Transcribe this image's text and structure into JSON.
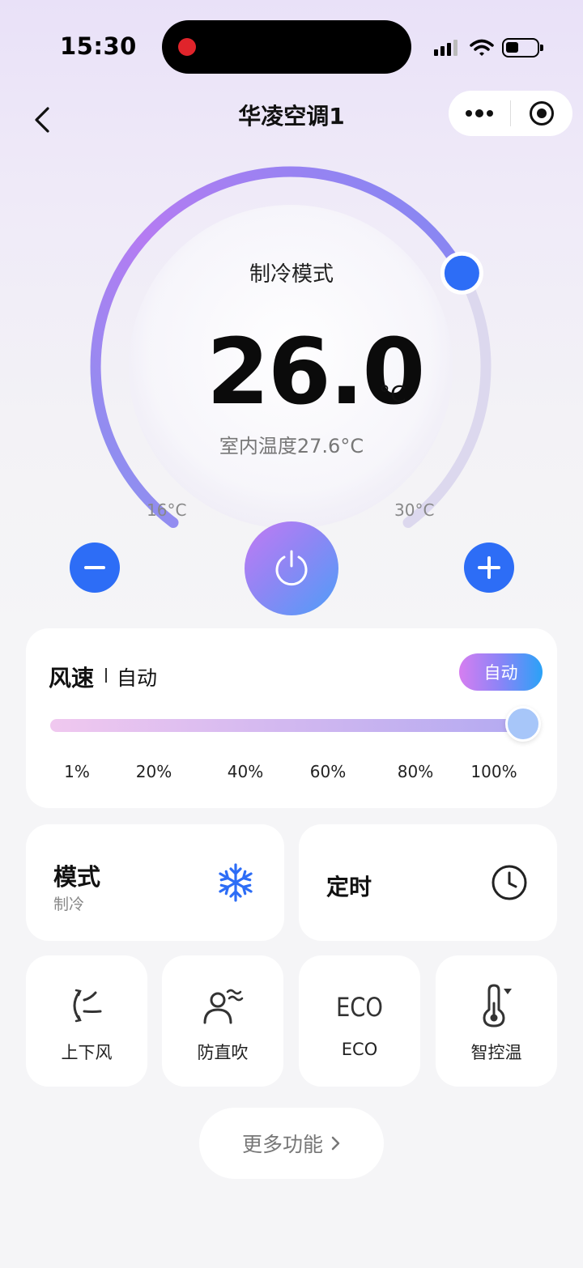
{
  "status_bar": {
    "time": "15:30"
  },
  "nav": {
    "title": "华凌空调1"
  },
  "thermostat": {
    "mode_label": "制冷模式",
    "set_temp": "26.0",
    "unit": "°C",
    "indoor_text": "室内温度27.6°C",
    "min_label": "16°C",
    "max_label": "30°C",
    "min_value": 16,
    "max_value": 30,
    "current_value": 26
  },
  "fan": {
    "title": "风速",
    "value": "自动",
    "auto_button": "自动",
    "level_percent": 100,
    "ticks": [
      "1%",
      "20%",
      "40%",
      "60%",
      "80%",
      "100%"
    ]
  },
  "mode_card": {
    "title": "模式",
    "subtitle": "制冷"
  },
  "timer_card": {
    "title": "定时"
  },
  "functions": [
    {
      "label": "上下风",
      "icon": "swing-icon"
    },
    {
      "label": "防直吹",
      "icon": "anti-direct-blow-icon"
    },
    {
      "label": "ECO",
      "icon": "eco-icon",
      "icon_text": "ECO"
    },
    {
      "label": "智控温",
      "icon": "smart-thermometer-icon"
    }
  ],
  "more": {
    "label": "更多功能"
  },
  "colors": {
    "accent_blue": "#2d6df6",
    "arc_purple": "#b57bf2",
    "arc_track": "#dcd8ee"
  }
}
